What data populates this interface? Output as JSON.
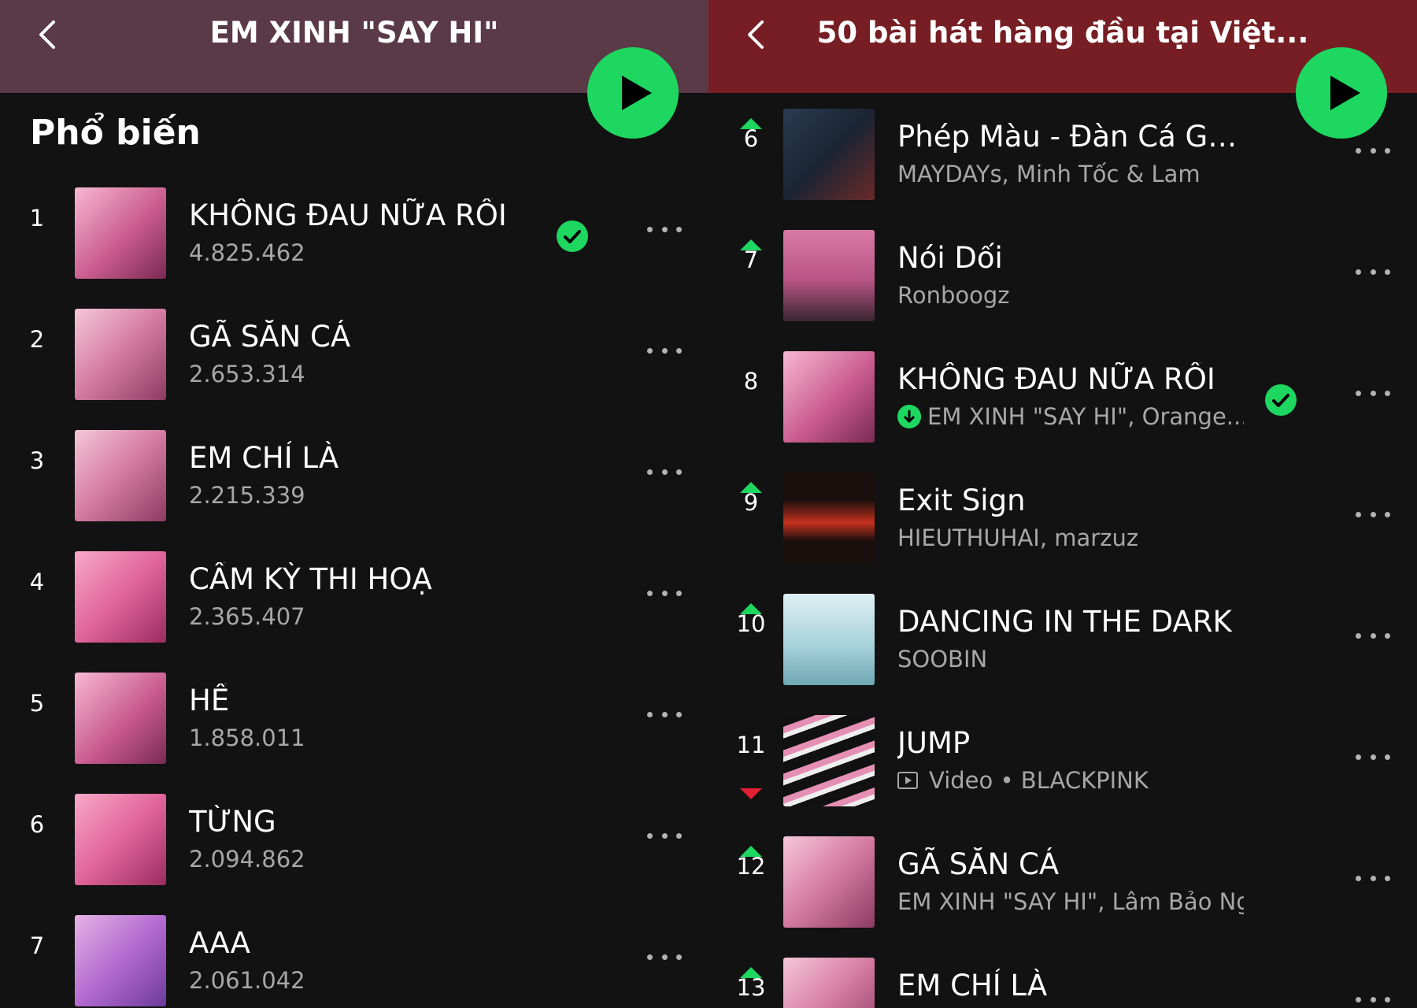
{
  "left": {
    "header_title": "EM XINH \"SAY HI\"",
    "section_title": "Phổ biến",
    "tracks": [
      {
        "rank": "1",
        "title": "KHÔNG ĐAU NỮA RỒI",
        "plays": "4.825.462",
        "saved": true
      },
      {
        "rank": "2",
        "title": "GÃ SĂN CÁ",
        "plays": "2.653.314"
      },
      {
        "rank": "3",
        "title": "EM CHỈ LÀ",
        "plays": "2.215.339"
      },
      {
        "rank": "4",
        "title": "CẦM KỲ THI HOẠ",
        "plays": "2.365.407"
      },
      {
        "rank": "5",
        "title": "HỀ",
        "plays": "1.858.011"
      },
      {
        "rank": "6",
        "title": "TỪNG",
        "plays": "2.094.862"
      },
      {
        "rank": "7",
        "title": "AAA",
        "plays": "2.061.042"
      }
    ]
  },
  "right": {
    "header_title": "50 bài hát hàng đầu tại Việt...",
    "tracks": [
      {
        "rank": "6",
        "title": "Phép Màu - Đàn Cá Gỗ Origin...",
        "artist": "MAYDAYs, Minh Tốc & Lam",
        "trend": "up"
      },
      {
        "rank": "7",
        "title": "Nói Dối",
        "artist": "Ronboogz",
        "trend": "up"
      },
      {
        "rank": "8",
        "title": "KHÔNG ĐAU NỮA RỒI",
        "artist": "EM XINH \"SAY HI\", Orange...",
        "trend": "none",
        "downloaded": true,
        "saved": true
      },
      {
        "rank": "9",
        "title": "Exit Sign",
        "artist": "HIEUTHUHAI, marzuz",
        "trend": "up"
      },
      {
        "rank": "10",
        "title": "DANCING IN THE DARK",
        "artist": "SOOBIN",
        "trend": "up"
      },
      {
        "rank": "11",
        "title": "JUMP",
        "artist": "Video • BLACKPINK",
        "trend": "down",
        "video": true
      },
      {
        "rank": "12",
        "title": "GÃ SĂN CÁ",
        "artist": "EM XINH \"SAY HI\", Lâm Bảo Ngọc, Qu...",
        "trend": "up"
      },
      {
        "rank": "13",
        "title": "EM CHỈ LÀ",
        "artist": "",
        "trend": "up"
      }
    ]
  },
  "icons": {
    "back": "chevron-left-icon",
    "play": "play-icon",
    "more": "more-dots-icon",
    "saved": "check-circle-icon",
    "download": "download-icon",
    "video": "video-icon"
  },
  "colors": {
    "accent": "#1ed760",
    "left_header": "#5a3a46",
    "right_header": "#761e24",
    "trend_down": "#e22134"
  }
}
